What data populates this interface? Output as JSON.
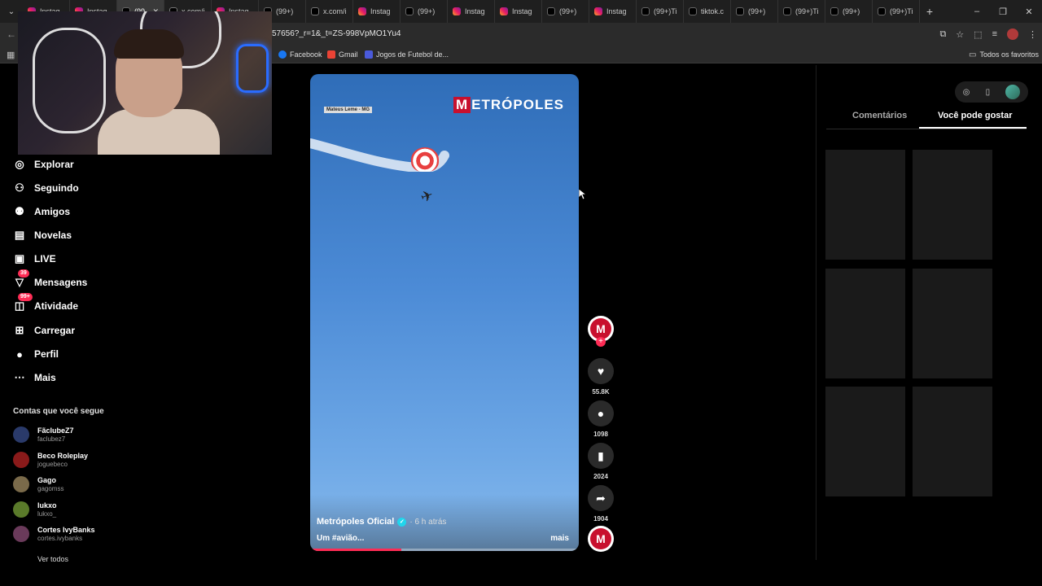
{
  "browser": {
    "tabs": [
      {
        "label": "Instag",
        "type": "ig",
        "active": false
      },
      {
        "label": "Instag",
        "type": "ig",
        "active": false
      },
      {
        "label": "(99",
        "type": "tt",
        "active": true
      },
      {
        "label": "x.com/i",
        "type": "x",
        "active": false
      },
      {
        "label": "Instag",
        "type": "ig",
        "active": false
      },
      {
        "label": "(99+)",
        "type": "tt",
        "active": false
      },
      {
        "label": "x.com/i",
        "type": "x",
        "active": false
      },
      {
        "label": "Instag",
        "type": "ig",
        "active": false
      },
      {
        "label": "(99+)",
        "type": "tt",
        "active": false
      },
      {
        "label": "Instag",
        "type": "ig",
        "active": false
      },
      {
        "label": "Instag",
        "type": "ig",
        "active": false
      },
      {
        "label": "(99+)",
        "type": "tt",
        "active": false
      },
      {
        "label": "Instag",
        "type": "ig",
        "active": false
      },
      {
        "label": "(99+)Ti",
        "type": "tt",
        "active": false
      },
      {
        "label": "tiktok.c",
        "type": "tt",
        "active": false
      },
      {
        "label": "(99+)",
        "type": "tt",
        "active": false
      },
      {
        "label": "(99+)Ti",
        "type": "tt",
        "active": false
      },
      {
        "label": "(99+)",
        "type": "tt",
        "active": false
      },
      {
        "label": "(99+)Ti",
        "type": "tt",
        "active": false
      }
    ],
    "url_fragment": "57656?_r=1&_t=ZS-998VpMO1Yu4",
    "bookmarks": {
      "facebook": "Facebook",
      "gmail": "Gmail",
      "jogos": "Jogos de Futebol de...",
      "all_bookmarks": "Todos os favoritos"
    }
  },
  "sidebar": {
    "nav": [
      {
        "label": "Explorar",
        "icon": "compass-icon",
        "glyph": "◎"
      },
      {
        "label": "Seguindo",
        "icon": "following-icon",
        "glyph": "⚇"
      },
      {
        "label": "Amigos",
        "icon": "friends-icon",
        "glyph": "⚉"
      },
      {
        "label": "Novelas",
        "icon": "novelas-icon",
        "glyph": "▤"
      },
      {
        "label": "LIVE",
        "icon": "live-icon",
        "glyph": "▣"
      },
      {
        "label": "Mensagens",
        "icon": "messages-icon",
        "glyph": "▽",
        "badge": "39"
      },
      {
        "label": "Atividade",
        "icon": "activity-icon",
        "glyph": "◫",
        "badge": "99+"
      },
      {
        "label": "Carregar",
        "icon": "upload-icon",
        "glyph": "⊞"
      },
      {
        "label": "Perfil",
        "icon": "profile-icon",
        "glyph": "●"
      },
      {
        "label": "Mais",
        "icon": "more-icon",
        "glyph": "⋯"
      }
    ],
    "following_title": "Contas que você segue",
    "accounts": [
      {
        "name": "FãclubeZ7",
        "handle": "faclubez7",
        "color": "#2a3a6a"
      },
      {
        "name": "Beco Roleplay",
        "handle": "joguebeco",
        "color": "#8a1a1a"
      },
      {
        "name": "Gago",
        "handle": "gagomss",
        "color": "#7a6a4a"
      },
      {
        "name": "lukxo",
        "handle": "lukxo_",
        "color": "#5a7a2a"
      },
      {
        "name": "Cortes IvyBanks",
        "handle": "cortes.ivybanks",
        "color": "#6a3a5a"
      }
    ],
    "see_all": "Ver todos"
  },
  "video": {
    "location_tag": "Mateus Leme - MG",
    "logo_text": "ETRÓPOLES",
    "logo_mark": "M",
    "author": "Metrópoles Oficial",
    "posted": "· 6 h atrás",
    "caption": "Um #avião...",
    "more": "mais",
    "progress": 0.34
  },
  "actions": {
    "likes": "55.8K",
    "comments": "1098",
    "saves": "2024",
    "shares": "1904"
  },
  "right_panel": {
    "tab_comments": "Comentários",
    "tab_suggested": "Você pode gostar"
  },
  "colors": {
    "accent": "#fe2c55",
    "brand_red": "#c8102e",
    "verified": "#20d5ec"
  }
}
